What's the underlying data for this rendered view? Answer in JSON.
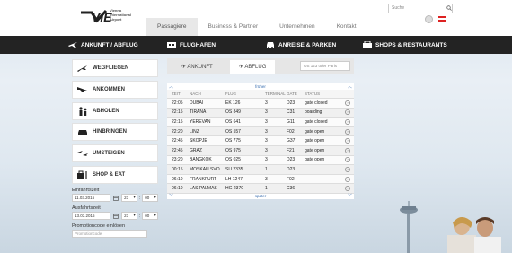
{
  "brand": {
    "logo_text": "VIE",
    "logo_sub": [
      "Vienna",
      "International",
      "Airport"
    ]
  },
  "search": {
    "placeholder": "Suche"
  },
  "topnav": [
    "Passagiere",
    "Business & Partner",
    "Unternehmen",
    "Kontakt"
  ],
  "mainnav": [
    {
      "label": "ANKUNFT / ABFLUG",
      "icon": "plane-icon"
    },
    {
      "label": "FLUGHAFEN",
      "icon": "building-icon"
    },
    {
      "label": "ANREISE & PARKEN",
      "icon": "car-icon"
    },
    {
      "label": "SHOPS & RESTAURANTS",
      "icon": "shop-icon"
    }
  ],
  "sidebar": [
    {
      "label": "WEGFLIEGEN",
      "icon": "takeoff-icon"
    },
    {
      "label": "ANKOMMEN",
      "icon": "landing-icon"
    },
    {
      "label": "ABHOLEN",
      "icon": "pickup-icon"
    },
    {
      "label": "HINBRINGEN",
      "icon": "car-dropoff-icon"
    },
    {
      "label": "UMSTEIGEN",
      "icon": "transfer-icon"
    },
    {
      "label": "SHOP & EAT",
      "icon": "shop-eat-icon"
    }
  ],
  "form": {
    "einfahrt_label": "Einfahrtszeit",
    "einfahrt_date": "11.03.2015",
    "einfahrt_hour": "23",
    "einfahrt_min": "00",
    "ausfahrt_label": "Ausfahrtszeit",
    "ausfahrt_date": "13.03.2015",
    "ausfahrt_hour": "23",
    "ausfahrt_min": "00",
    "promo_label": "Promotioncode einlösen",
    "promo_placeholder": "Promotioncode"
  },
  "panel": {
    "tab_arrival": "ANKUNFT",
    "tab_departure": "ABFLUG",
    "search_placeholder": "OS 123 oder Paris",
    "earlier": "früher",
    "later": "später",
    "columns": [
      "ZEIT",
      "NACH",
      "FLUG",
      "TERMINAL",
      "GATE",
      "STATUS"
    ]
  },
  "flights": [
    {
      "time": "22:05",
      "dest": "DUBAI",
      "flight": "EK 126",
      "terminal": "3",
      "gate": "D23",
      "status": "gate closed"
    },
    {
      "time": "22:15",
      "dest": "TIRANA",
      "flight": "OS 849",
      "terminal": "3",
      "gate": "C31",
      "status": "boarding"
    },
    {
      "time": "22:15",
      "dest": "YEREVAN",
      "flight": "OS 641",
      "terminal": "3",
      "gate": "G11",
      "status": "gate closed"
    },
    {
      "time": "22:20",
      "dest": "LINZ",
      "flight": "OS 557",
      "terminal": "3",
      "gate": "F02",
      "status": "gate open"
    },
    {
      "time": "22:45",
      "dest": "SKOPJE",
      "flight": "OS 775",
      "terminal": "3",
      "gate": "G37",
      "status": "gate open"
    },
    {
      "time": "22:45",
      "dest": "GRAZ",
      "flight": "OS 975",
      "terminal": "3",
      "gate": "F21",
      "status": "gate open"
    },
    {
      "time": "23:20",
      "dest": "BANGKOK",
      "flight": "OS 025",
      "terminal": "3",
      "gate": "D23",
      "status": "gate open"
    },
    {
      "time": "00:15",
      "dest": "MOSKAU SVO",
      "flight": "SU 2335",
      "terminal": "1",
      "gate": "D23",
      "status": ""
    },
    {
      "time": "06:10",
      "dest": "FRANKFURT",
      "flight": "LH 1247",
      "terminal": "3",
      "gate": "F02",
      "status": ""
    },
    {
      "time": "06:10",
      "dest": "LAS PALMAS",
      "flight": "HG 2370",
      "terminal": "1",
      "gate": "C36",
      "status": ""
    }
  ]
}
